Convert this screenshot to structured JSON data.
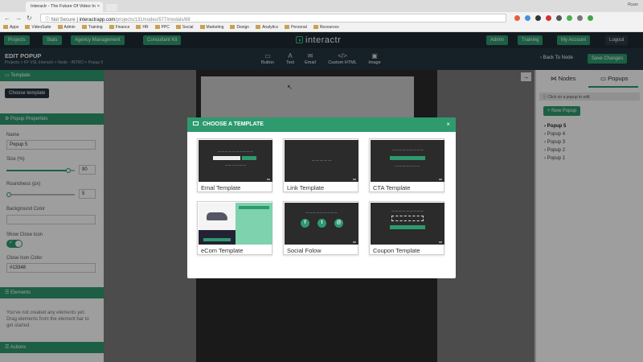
{
  "browser": {
    "tab_title": "Interactr - The Future Of Video In",
    "tab_close": "×",
    "user_name": "Ryan",
    "back": "←",
    "forward": "→",
    "reload": "↻",
    "security": "ⓘ Not Secure",
    "url_host": "interactrapp.com",
    "url_path": "/projects/131/nodes/577/modals/88",
    "extension_colors": [
      "#e85d3a",
      "#4a8fd8",
      "#333333",
      "#cc3333",
      "#555555",
      "#4caf50",
      "#777777",
      "#3ea64a"
    ],
    "bookmarks": [
      "Apps",
      "VideoSuite",
      "Admin",
      "Training",
      "Finance",
      "HR",
      "PPC",
      "Social",
      "Marketing",
      "Design",
      "Analytics",
      "Personal",
      "Resources"
    ]
  },
  "header": {
    "projects": "Projects",
    "stats": "Stats",
    "agency": "Agency Management",
    "consultant": "Consultant Kit",
    "logo": "interactr",
    "admin": "Admin",
    "training": "Training",
    "account": "My Account",
    "logout": "Logout"
  },
  "subheader": {
    "title": "EDIT POPUP",
    "breadcrumb": "Projects  >  FF VSL Interactr  >  Node - INTRO  >  Popup 5",
    "tools": [
      {
        "icon": "▭",
        "label": "Button"
      },
      {
        "icon": "A",
        "label": "Text"
      },
      {
        "icon": "✉",
        "label": "Email"
      },
      {
        "icon": "</>",
        "label": "Custom HTML"
      },
      {
        "icon": "▣",
        "label": "Image"
      }
    ],
    "back_to_node": "‹ Back To Node",
    "save": "Save Changes"
  },
  "left": {
    "template_head": "Template",
    "choose_template": "Choose template",
    "props_head": "Popup Properties",
    "name_label": "Name",
    "name_value": "Popup 5",
    "size_label": "Size (%)",
    "size_value": "90",
    "size_fraction": 0.9,
    "round_label": "Roundness (px)",
    "round_value": "5",
    "bg_label": "Background Color",
    "show_close_label": "Show Close Icon",
    "toggle_check": "✓",
    "close_color_label": "Close Icon Color",
    "close_color_value": "#13348",
    "elements_head": "Elements",
    "elements_note": "You've not created any elements yet. Drag elements from the element bar to get started.",
    "actions_head": "Actions"
  },
  "canvas": {
    "close": "×",
    "collapse": "→"
  },
  "right": {
    "tab_nodes": "Nodes",
    "tab_popups": "Popups",
    "hint": "Click on a popup to edit",
    "new_popup": "+ New Popup",
    "popups": [
      "Popup 5",
      "Popup 4",
      "Popup 3",
      "Popup 2",
      "Popup 1"
    ]
  },
  "modal": {
    "title": "CHOOSE A TEMPLATE",
    "close": "×",
    "templates": [
      {
        "label": "Emal Template"
      },
      {
        "label": "Link Template"
      },
      {
        "label": "CTA Template"
      },
      {
        "label": "eCom Template"
      },
      {
        "label": "Social Folow"
      },
      {
        "label": "Coupon Template"
      }
    ]
  },
  "colors": {
    "accent": "#2e9a6e",
    "header_dark": "#1e2b33",
    "subheader": "#243640"
  }
}
